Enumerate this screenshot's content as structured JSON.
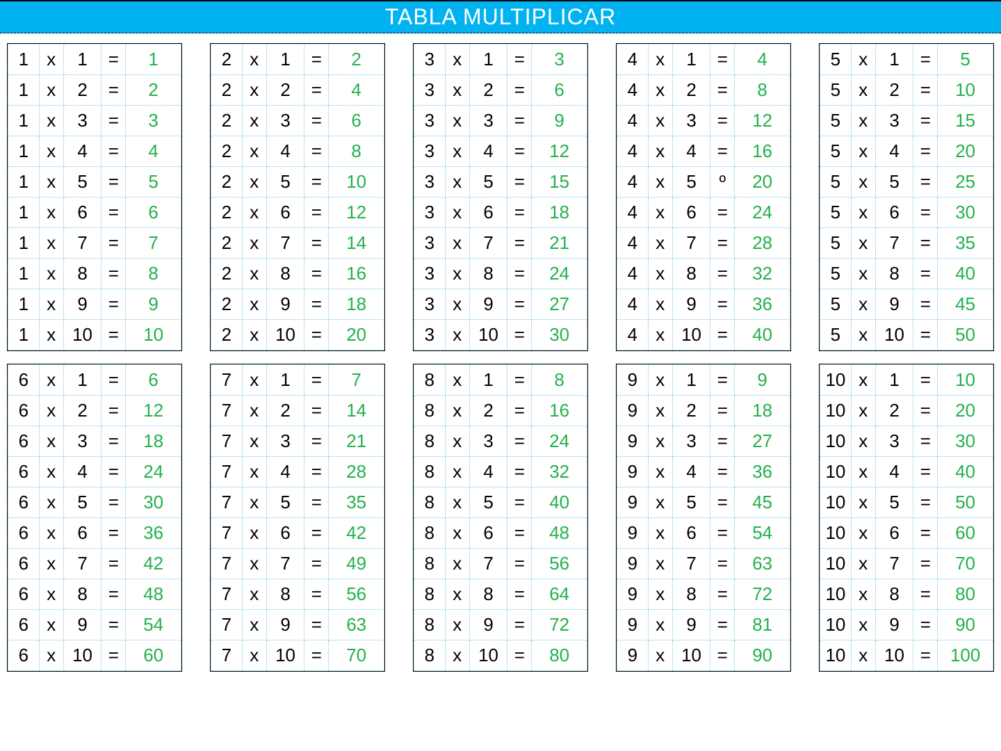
{
  "title": "TABLA MULTIPLICAR",
  "symbols": {
    "times": "x",
    "equals": "="
  },
  "tables": [
    {
      "factor": 1,
      "rows": [
        {
          "b": 1,
          "eq": "=",
          "r": 1
        },
        {
          "b": 2,
          "eq": "=",
          "r": 2
        },
        {
          "b": 3,
          "eq": "=",
          "r": 3
        },
        {
          "b": 4,
          "eq": "=",
          "r": 4
        },
        {
          "b": 5,
          "eq": "=",
          "r": 5
        },
        {
          "b": 6,
          "eq": "=",
          "r": 6
        },
        {
          "b": 7,
          "eq": "=",
          "r": 7
        },
        {
          "b": 8,
          "eq": "=",
          "r": 8
        },
        {
          "b": 9,
          "eq": "=",
          "r": 9
        },
        {
          "b": 10,
          "eq": "=",
          "r": 10
        }
      ]
    },
    {
      "factor": 2,
      "rows": [
        {
          "b": 1,
          "eq": "=",
          "r": 2
        },
        {
          "b": 2,
          "eq": "=",
          "r": 4
        },
        {
          "b": 3,
          "eq": "=",
          "r": 6
        },
        {
          "b": 4,
          "eq": "=",
          "r": 8
        },
        {
          "b": 5,
          "eq": "=",
          "r": 10
        },
        {
          "b": 6,
          "eq": "=",
          "r": 12
        },
        {
          "b": 7,
          "eq": "=",
          "r": 14
        },
        {
          "b": 8,
          "eq": "=",
          "r": 16
        },
        {
          "b": 9,
          "eq": "=",
          "r": 18
        },
        {
          "b": 10,
          "eq": "=",
          "r": 20
        }
      ]
    },
    {
      "factor": 3,
      "rows": [
        {
          "b": 1,
          "eq": "=",
          "r": 3
        },
        {
          "b": 2,
          "eq": "=",
          "r": 6
        },
        {
          "b": 3,
          "eq": "=",
          "r": 9
        },
        {
          "b": 4,
          "eq": "=",
          "r": 12
        },
        {
          "b": 5,
          "eq": "=",
          "r": 15
        },
        {
          "b": 6,
          "eq": "=",
          "r": 18
        },
        {
          "b": 7,
          "eq": "=",
          "r": 21
        },
        {
          "b": 8,
          "eq": "=",
          "r": 24
        },
        {
          "b": 9,
          "eq": "=",
          "r": 27
        },
        {
          "b": 10,
          "eq": "=",
          "r": 30
        }
      ]
    },
    {
      "factor": 4,
      "rows": [
        {
          "b": 1,
          "eq": "=",
          "r": 4
        },
        {
          "b": 2,
          "eq": "=",
          "r": 8
        },
        {
          "b": 3,
          "eq": "=",
          "r": 12
        },
        {
          "b": 4,
          "eq": "=",
          "r": 16
        },
        {
          "b": 5,
          "eq": "º",
          "r": 20
        },
        {
          "b": 6,
          "eq": "=",
          "r": 24
        },
        {
          "b": 7,
          "eq": "=",
          "r": 28
        },
        {
          "b": 8,
          "eq": "=",
          "r": 32
        },
        {
          "b": 9,
          "eq": "=",
          "r": 36
        },
        {
          "b": 10,
          "eq": "=",
          "r": 40
        }
      ]
    },
    {
      "factor": 5,
      "rows": [
        {
          "b": 1,
          "eq": "=",
          "r": 5
        },
        {
          "b": 2,
          "eq": "=",
          "r": 10
        },
        {
          "b": 3,
          "eq": "=",
          "r": 15
        },
        {
          "b": 4,
          "eq": "=",
          "r": 20
        },
        {
          "b": 5,
          "eq": "=",
          "r": 25
        },
        {
          "b": 6,
          "eq": "=",
          "r": 30
        },
        {
          "b": 7,
          "eq": "=",
          "r": 35
        },
        {
          "b": 8,
          "eq": "=",
          "r": 40
        },
        {
          "b": 9,
          "eq": "=",
          "r": 45
        },
        {
          "b": 10,
          "eq": "=",
          "r": 50
        }
      ]
    },
    {
      "factor": 6,
      "rows": [
        {
          "b": 1,
          "eq": "=",
          "r": 6
        },
        {
          "b": 2,
          "eq": "=",
          "r": 12
        },
        {
          "b": 3,
          "eq": "=",
          "r": 18
        },
        {
          "b": 4,
          "eq": "=",
          "r": 24
        },
        {
          "b": 5,
          "eq": "=",
          "r": 30
        },
        {
          "b": 6,
          "eq": "=",
          "r": 36
        },
        {
          "b": 7,
          "eq": "=",
          "r": 42
        },
        {
          "b": 8,
          "eq": "=",
          "r": 48
        },
        {
          "b": 9,
          "eq": "=",
          "r": 54
        },
        {
          "b": 10,
          "eq": "=",
          "r": 60
        }
      ]
    },
    {
      "factor": 7,
      "rows": [
        {
          "b": 1,
          "eq": "=",
          "r": 7
        },
        {
          "b": 2,
          "eq": "=",
          "r": 14
        },
        {
          "b": 3,
          "eq": "=",
          "r": 21
        },
        {
          "b": 4,
          "eq": "=",
          "r": 28
        },
        {
          "b": 5,
          "eq": "=",
          "r": 35
        },
        {
          "b": 6,
          "eq": "=",
          "r": 42
        },
        {
          "b": 7,
          "eq": "=",
          "r": 49
        },
        {
          "b": 8,
          "eq": "=",
          "r": 56
        },
        {
          "b": 9,
          "eq": "=",
          "r": 63
        },
        {
          "b": 10,
          "eq": "=",
          "r": 70
        }
      ]
    },
    {
      "factor": 8,
      "rows": [
        {
          "b": 1,
          "eq": "=",
          "r": 8
        },
        {
          "b": 2,
          "eq": "=",
          "r": 16
        },
        {
          "b": 3,
          "eq": "=",
          "r": 24
        },
        {
          "b": 4,
          "eq": "=",
          "r": 32
        },
        {
          "b": 5,
          "eq": "=",
          "r": 40
        },
        {
          "b": 6,
          "eq": "=",
          "r": 48
        },
        {
          "b": 7,
          "eq": "=",
          "r": 56
        },
        {
          "b": 8,
          "eq": "=",
          "r": 64
        },
        {
          "b": 9,
          "eq": "=",
          "r": 72
        },
        {
          "b": 10,
          "eq": "=",
          "r": 80
        }
      ]
    },
    {
      "factor": 9,
      "rows": [
        {
          "b": 1,
          "eq": "=",
          "r": 9
        },
        {
          "b": 2,
          "eq": "=",
          "r": 18
        },
        {
          "b": 3,
          "eq": "=",
          "r": 27
        },
        {
          "b": 4,
          "eq": "=",
          "r": 36
        },
        {
          "b": 5,
          "eq": "=",
          "r": 45
        },
        {
          "b": 6,
          "eq": "=",
          "r": 54
        },
        {
          "b": 7,
          "eq": "=",
          "r": 63
        },
        {
          "b": 8,
          "eq": "=",
          "r": 72
        },
        {
          "b": 9,
          "eq": "=",
          "r": 81
        },
        {
          "b": 10,
          "eq": "=",
          "r": 90
        }
      ]
    },
    {
      "factor": 10,
      "rows": [
        {
          "b": 1,
          "eq": "=",
          "r": 10
        },
        {
          "b": 2,
          "eq": "=",
          "r": 20
        },
        {
          "b": 3,
          "eq": "=",
          "r": 30
        },
        {
          "b": 4,
          "eq": "=",
          "r": 40
        },
        {
          "b": 5,
          "eq": "=",
          "r": 50
        },
        {
          "b": 6,
          "eq": "=",
          "r": 60
        },
        {
          "b": 7,
          "eq": "=",
          "r": 70
        },
        {
          "b": 8,
          "eq": "=",
          "r": 80
        },
        {
          "b": 9,
          "eq": "=",
          "r": 90
        },
        {
          "b": 10,
          "eq": "=",
          "r": 100
        }
      ]
    }
  ]
}
